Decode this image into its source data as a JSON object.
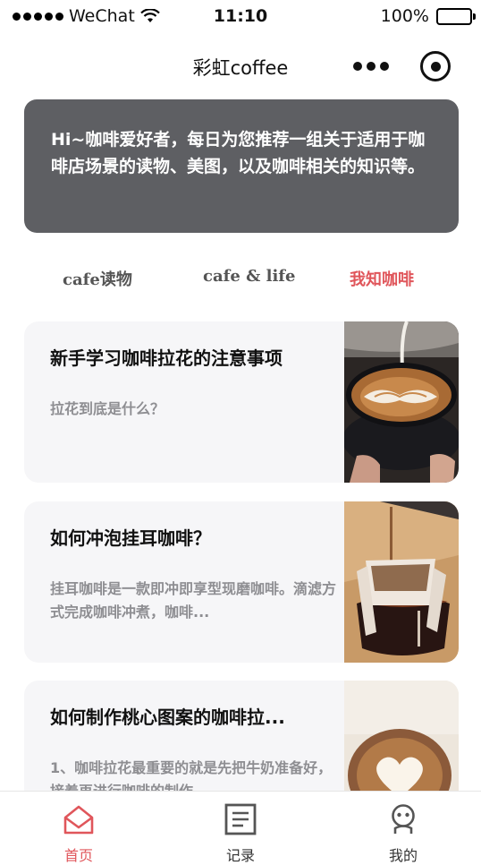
{
  "status": {
    "carrier": "WeChat",
    "time": "11:10",
    "battery_text": "100%",
    "battery_level": 1.0
  },
  "nav": {
    "title": "彩虹coffee",
    "more_icon": "more-dots-icon",
    "target_icon": "target-icon"
  },
  "intro": {
    "text": "Hi~咖啡爱好者，每日为您推荐一组关于适用于咖啡店场景的读物、美图，以及咖啡相关的知识等。"
  },
  "tabs": [
    {
      "label": "cafe读物",
      "active": false
    },
    {
      "label": "cafe & life",
      "active": false
    },
    {
      "label": "我知咖啡",
      "active": true
    }
  ],
  "articles": [
    {
      "title": "新手学习咖啡拉花的注意事项",
      "desc": "拉花到底是什么？"
    },
    {
      "title": "如何冲泡挂耳咖啡？",
      "desc": "挂耳咖啡是一款即冲即享型现磨咖啡。滴滤方式完成咖啡冲煮，咖啡..."
    },
    {
      "title": "如何制作桃心图案的咖啡拉...",
      "desc": "1、咖啡拉花最重要的就是先把牛奶准备好，接着再进行咖啡的制作。"
    }
  ],
  "tabbar": [
    {
      "label": "首页",
      "icon": "home-icon",
      "active": true
    },
    {
      "label": "记录",
      "icon": "document-icon",
      "active": false
    },
    {
      "label": "我的",
      "icon": "profile-icon",
      "active": false
    }
  ],
  "colors": {
    "accent": "#e0565b",
    "intro_bg": "#5e5f63",
    "card_bg": "#f6f6f8"
  }
}
